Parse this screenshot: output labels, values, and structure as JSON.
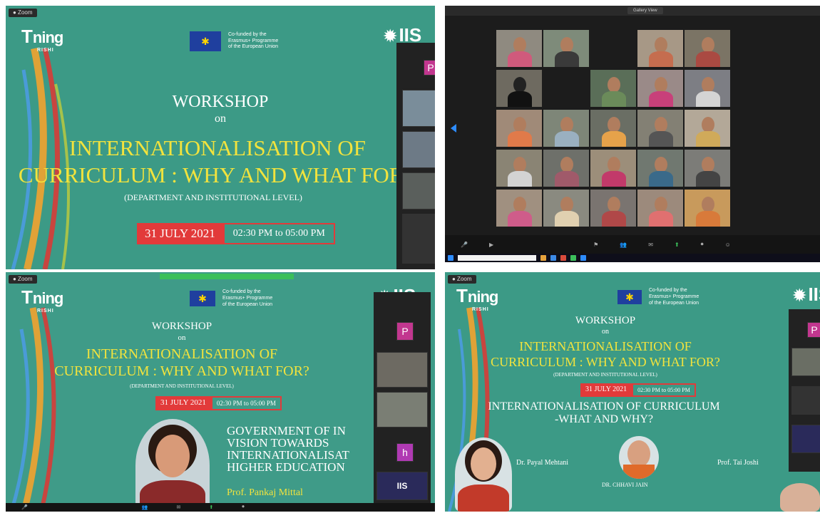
{
  "colors": {
    "slide_bg": "#3c9a86",
    "accent_red": "#e23a3a",
    "title_yellow": "#f2e33d",
    "eu_blue": "#1f3f9e"
  },
  "logo": {
    "prefix": "T",
    "main": "ning",
    "sub": "RISHI"
  },
  "eu_text": "Co-funded by the\nErasmus+ Programme\nof the European Union",
  "iis": "IIS",
  "slide": {
    "workshop": "WORKSHOP",
    "on": "on",
    "title1": "INTERNATIONALISATION OF",
    "title2": "CURRICULUM : WHY AND WHAT FOR?",
    "level": "(DEPARTMENT AND INSTITUTIONAL LEVEL)",
    "date": "31 JULY 2021",
    "time": "02:30 PM to 05:00 PM"
  },
  "panel3": {
    "talk1": "GOVERNMENT OF IN",
    "talk2": "VISION TOWARDS",
    "talk3": "INTERNATIONALISAT",
    "talk4": "HIGHER EDUCATION",
    "speaker": "Prof. Pankaj Mittal"
  },
  "panel4": {
    "talk1": "INTERNATIONALISATION OF CURRICULUM",
    "talk2": "-WHAT AND WHY?",
    "speaker_left": "Dr. Payal Mehtani",
    "speaker_center": "DR. CHHAVI JAIN",
    "speaker_right": "Prof. Tai Joshi"
  },
  "side_tiles": {
    "p": "P",
    "h": "h"
  },
  "meeting_title": "Gallery View"
}
